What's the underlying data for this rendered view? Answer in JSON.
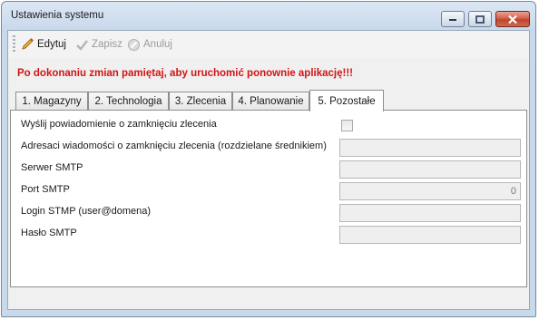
{
  "window": {
    "title": "Ustawienia systemu"
  },
  "toolbar": {
    "edit_label": "Edytuj",
    "save_label": "Zapisz",
    "cancel_label": "Anuluj"
  },
  "warning_text": "Po dokonaniu zmian pamiętaj, aby uruchomić  ponownie aplikację!!!",
  "tabs": [
    {
      "label": "1. Magazyny"
    },
    {
      "label": "2. Technologia"
    },
    {
      "label": "3. Zlecenia"
    },
    {
      "label": "4. Planowanie"
    },
    {
      "label": "5. Pozostałe"
    }
  ],
  "active_tab": "5. Pozostałe",
  "fields": {
    "notify_label": "Wyślij powiadomienie o zamknięciu zlecenia",
    "notify_checked": false,
    "recipients_label": "Adresaci wiadomości o zamknięciu zlecenia (rozdzielane średnikiem)",
    "recipients_value": "",
    "smtp_server_label": "Serwer SMTP",
    "smtp_server_value": "",
    "smtp_port_label": "Port SMTP",
    "smtp_port_value": "0",
    "smtp_login_label": "Login STMP (user@domena)",
    "smtp_login_value": "",
    "smtp_password_label": "Hasło SMTP",
    "smtp_password_value": ""
  },
  "colors": {
    "warning": "#d21414",
    "title_gradient_top": "#dce7f4",
    "title_gradient_bottom": "#c9d9ec",
    "close_button": "#c1432b"
  }
}
